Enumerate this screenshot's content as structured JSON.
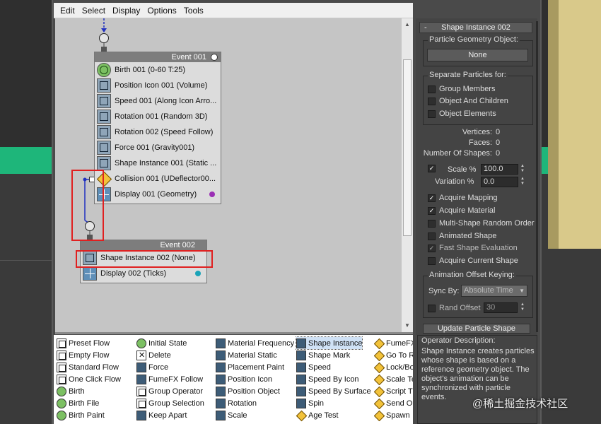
{
  "menu": [
    "Edit",
    "Select",
    "Display",
    "Options",
    "Tools"
  ],
  "events": {
    "event1": {
      "title": "Event 001",
      "operators": [
        "Birth 001 (0-60 T:25)",
        "Position Icon 001 (Volume)",
        "Speed 001 (Along Icon Arro...",
        "Rotation 001 (Random 3D)",
        "Rotation 002 (Speed Follow)",
        "Force 001 (Gravity001)",
        "Shape Instance 001 (Static ...",
        "Collision 001 (UDeflector00...",
        "Display 001 (Geometry)"
      ],
      "display_dot_color": "#9b2fb5"
    },
    "event2": {
      "title": "Event 002",
      "operators": [
        "Shape Instance 002 (None)",
        "Display 002 (Ticks)"
      ],
      "display_dot_color": "#1aa3b8"
    }
  },
  "panel": {
    "rollout_title": "Shape Instance 002",
    "rollout_toggle": "-",
    "geometry_group": "Particle Geometry Object:",
    "geometry_button": "None",
    "separate_group": "Separate Particles for:",
    "separate_options": [
      {
        "label": "Group Members",
        "checked": false
      },
      {
        "label": "Object And Children",
        "checked": false
      },
      {
        "label": "Object Elements",
        "checked": false
      }
    ],
    "stats": {
      "vertices_label": "Vertices:",
      "vertices": "0",
      "faces_label": "Faces:",
      "faces": "0",
      "shapes_label": "Number Of Shapes:",
      "shapes": "0"
    },
    "scale_label": "Scale %",
    "scale_value": "100.0",
    "scale_checked": true,
    "variation_label": "Variation %",
    "variation_value": "0.0",
    "options": [
      {
        "label": "Acquire Mapping",
        "checked": true
      },
      {
        "label": "Acquire Material",
        "checked": true
      },
      {
        "label": "Multi-Shape Random Order",
        "checked": false
      },
      {
        "label": "Animated Shape",
        "checked": false
      },
      {
        "label": "Fast Shape Evaluation",
        "checked": true
      },
      {
        "label": "Acquire Current Shape",
        "checked": false
      }
    ],
    "anim_group": "Animation Offset Keying:",
    "sync_label": "Sync By:",
    "sync_value": "Absolute Time",
    "rand_offset_label": "Rand Offset",
    "rand_offset_value": "30",
    "update_button": "Update Particle Shape"
  },
  "depot": [
    [
      "Preset Flow",
      "Empty Flow",
      "Standard Flow",
      "One Click Flow",
      "Birth",
      "Birth File",
      "Birth Paint"
    ],
    [
      "Initial State",
      "Delete",
      "Force",
      "FumeFX Follow",
      "Group Operator",
      "Group Selection",
      "Keep Apart"
    ],
    [
      "Material Frequency",
      "Material Static",
      "Placement Paint",
      "Position Icon",
      "Position Object",
      "Rotation",
      "Scale"
    ],
    [
      "Shape Instance",
      "Shape Mark",
      "Speed",
      "Speed By Icon",
      "Speed By Surface",
      "Spin",
      "Age Test"
    ],
    [
      "FumeFX",
      "Go To R",
      "Lock/Bo",
      "Scale Te",
      "Script T",
      "Send Ou",
      "Spawn"
    ]
  ],
  "description": {
    "title": "Operator Description:",
    "text": "Shape Instance creates particles whose shape is based on a reference geometry object. The object's animation can be synchronized with particle events."
  },
  "watermark": "@稀土掘金技术社区"
}
